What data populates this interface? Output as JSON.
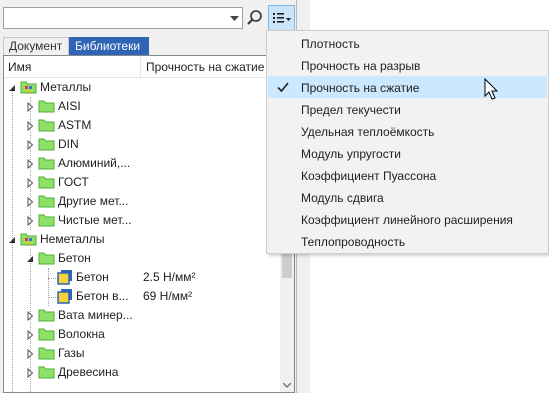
{
  "search": {
    "value": "",
    "placeholder": ""
  },
  "tabs": [
    {
      "label": "Документ"
    },
    {
      "label": "Библиотеки",
      "active": true
    }
  ],
  "columns": {
    "name": "Имя",
    "strength": "Прочность на сжатие"
  },
  "tree": [
    {
      "label": "Металлы",
      "value": ""
    },
    {
      "label": "AISI",
      "value": ""
    },
    {
      "label": "ASTM",
      "value": ""
    },
    {
      "label": "DIN",
      "value": ""
    },
    {
      "label": "Алюминий,...",
      "value": ""
    },
    {
      "label": "ГОСТ",
      "value": ""
    },
    {
      "label": "Другие мет...",
      "value": ""
    },
    {
      "label": "Чистые мет...",
      "value": ""
    },
    {
      "label": "Неметаллы",
      "value": ""
    },
    {
      "label": "Бетон",
      "value": ""
    },
    {
      "label": "Бетон",
      "value": "2.5 Н/мм²"
    },
    {
      "label": "Бетон в...",
      "value": "69 Н/мм²"
    },
    {
      "label": "Вата минер...",
      "value": ""
    },
    {
      "label": "Волокна",
      "value": ""
    },
    {
      "label": "Газы",
      "value": ""
    },
    {
      "label": "Древесина",
      "value": ""
    }
  ],
  "menu": {
    "items": [
      {
        "label": "Плотность",
        "checked": false
      },
      {
        "label": "Прочность на разрыв",
        "checked": false
      },
      {
        "label": "Прочность на сжатие",
        "checked": true
      },
      {
        "label": "Предел текучести",
        "checked": false
      },
      {
        "label": "Удельная теплоёмкость",
        "checked": false
      },
      {
        "label": "Модуль упругости",
        "checked": false
      },
      {
        "label": "Коэффициент Пуассона",
        "checked": false
      },
      {
        "label": "Модуль сдвига",
        "checked": false
      },
      {
        "label": "Коэффициент линейного расширения",
        "checked": false
      },
      {
        "label": "Теплопроводность",
        "checked": false
      }
    ]
  },
  "colors": {
    "active_tab": "#2f65b4",
    "menu_highlight": "#cce8ff",
    "folder": "#8ee06b",
    "material_icon": "#f5d23c"
  }
}
